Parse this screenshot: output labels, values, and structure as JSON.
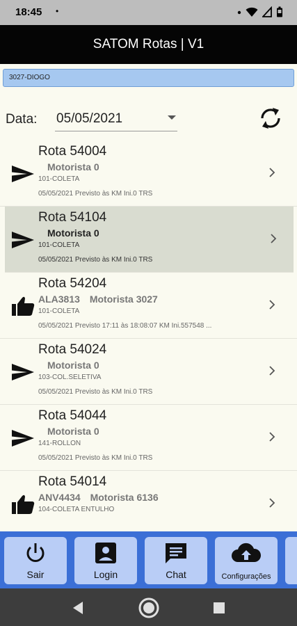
{
  "status_bar": {
    "time": "18:45",
    "dot": "•"
  },
  "app_bar": {
    "title": "SATOM Rotas | V1"
  },
  "user": {
    "label": "3027-DIOGO"
  },
  "date": {
    "label": "Data:",
    "value": "05/05/2021"
  },
  "routes": [
    {
      "title": "Rota 54004",
      "plate": "",
      "driver": "Motorista 0",
      "type": "101-COLETA",
      "detail": "05/05/2021   Previsto  às   KM Ini.0  TRS",
      "icon": "send-icon",
      "selected": false
    },
    {
      "title": "Rota 54104",
      "plate": "",
      "driver": "Motorista 0",
      "type": "101-COLETA",
      "detail": "05/05/2021   Previsto  às   KM Ini.0  TRS",
      "icon": "send-icon",
      "selected": true
    },
    {
      "title": "Rota 54204",
      "plate": "ALA3813",
      "driver": "Motorista 3027",
      "type": "101-COLETA",
      "detail": "05/05/2021   Previsto 17:11 às 18:08:07   KM Ini.557548   ...",
      "icon": "thumbs-up-icon",
      "selected": false
    },
    {
      "title": "Rota 54024",
      "plate": "",
      "driver": "Motorista 0",
      "type": "103-COL.SELETIVA",
      "detail": "05/05/2021   Previsto  às   KM Ini.0  TRS",
      "icon": "send-icon",
      "selected": false
    },
    {
      "title": "Rota 54044",
      "plate": "",
      "driver": "Motorista 0",
      "type": "141-ROLLON",
      "detail": "05/05/2021   Previsto  às   KM Ini.0  TRS",
      "icon": "send-icon",
      "selected": false
    },
    {
      "title": "Rota 54014",
      "plate": "ANV4434",
      "driver": "Motorista 6136",
      "type": "104-COLETA ENTULHO",
      "detail": "",
      "icon": "thumbs-up-icon",
      "selected": false
    }
  ],
  "bottom_nav": {
    "sair": "Sair",
    "login": "Login",
    "chat": "Chat",
    "configuracoes": "Configurações"
  },
  "colors": {
    "app_bar": "#050505",
    "nav_bar": "#3b6fd6",
    "nav_button": "#b9cdf6",
    "user_chip": "#a6c8f0",
    "selected_row": "#d9dcd0"
  }
}
